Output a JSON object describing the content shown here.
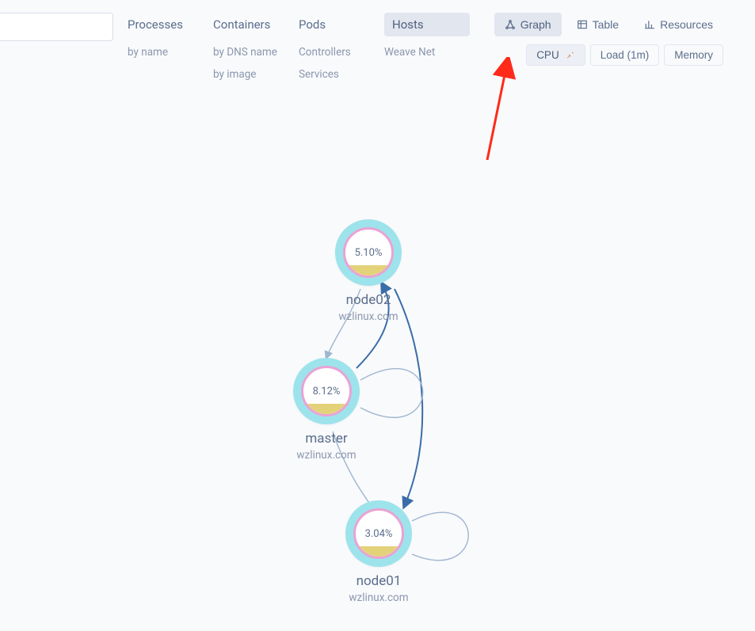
{
  "search": {
    "value": "",
    "placeholder": ""
  },
  "filters": [
    {
      "header": "Processes",
      "subs": [
        "by name"
      ]
    },
    {
      "header": "Containers",
      "subs": [
        "by DNS name",
        "by image"
      ]
    },
    {
      "header": "Pods",
      "subs": [
        "Controllers",
        "Services"
      ]
    },
    {
      "header": "Hosts",
      "subs": [
        "Weave Net"
      ],
      "active": true
    }
  ],
  "views": {
    "graph": {
      "label": "Graph",
      "active": true
    },
    "table": {
      "label": "Table"
    },
    "resources": {
      "label": "Resources"
    }
  },
  "metrics": {
    "cpu": {
      "label": "CPU",
      "active": true,
      "pinned": true
    },
    "load": {
      "label": "Load (1m)"
    },
    "memory": {
      "label": "Memory"
    }
  },
  "nodes": {
    "node02": {
      "name": "node02",
      "domain": "wzlinux.com",
      "value": "5.10%"
    },
    "master": {
      "name": "master",
      "domain": "wzlinux.com",
      "value": "8.12%"
    },
    "node01": {
      "name": "node01",
      "domain": "wzlinux.com",
      "value": "3.04%"
    }
  }
}
